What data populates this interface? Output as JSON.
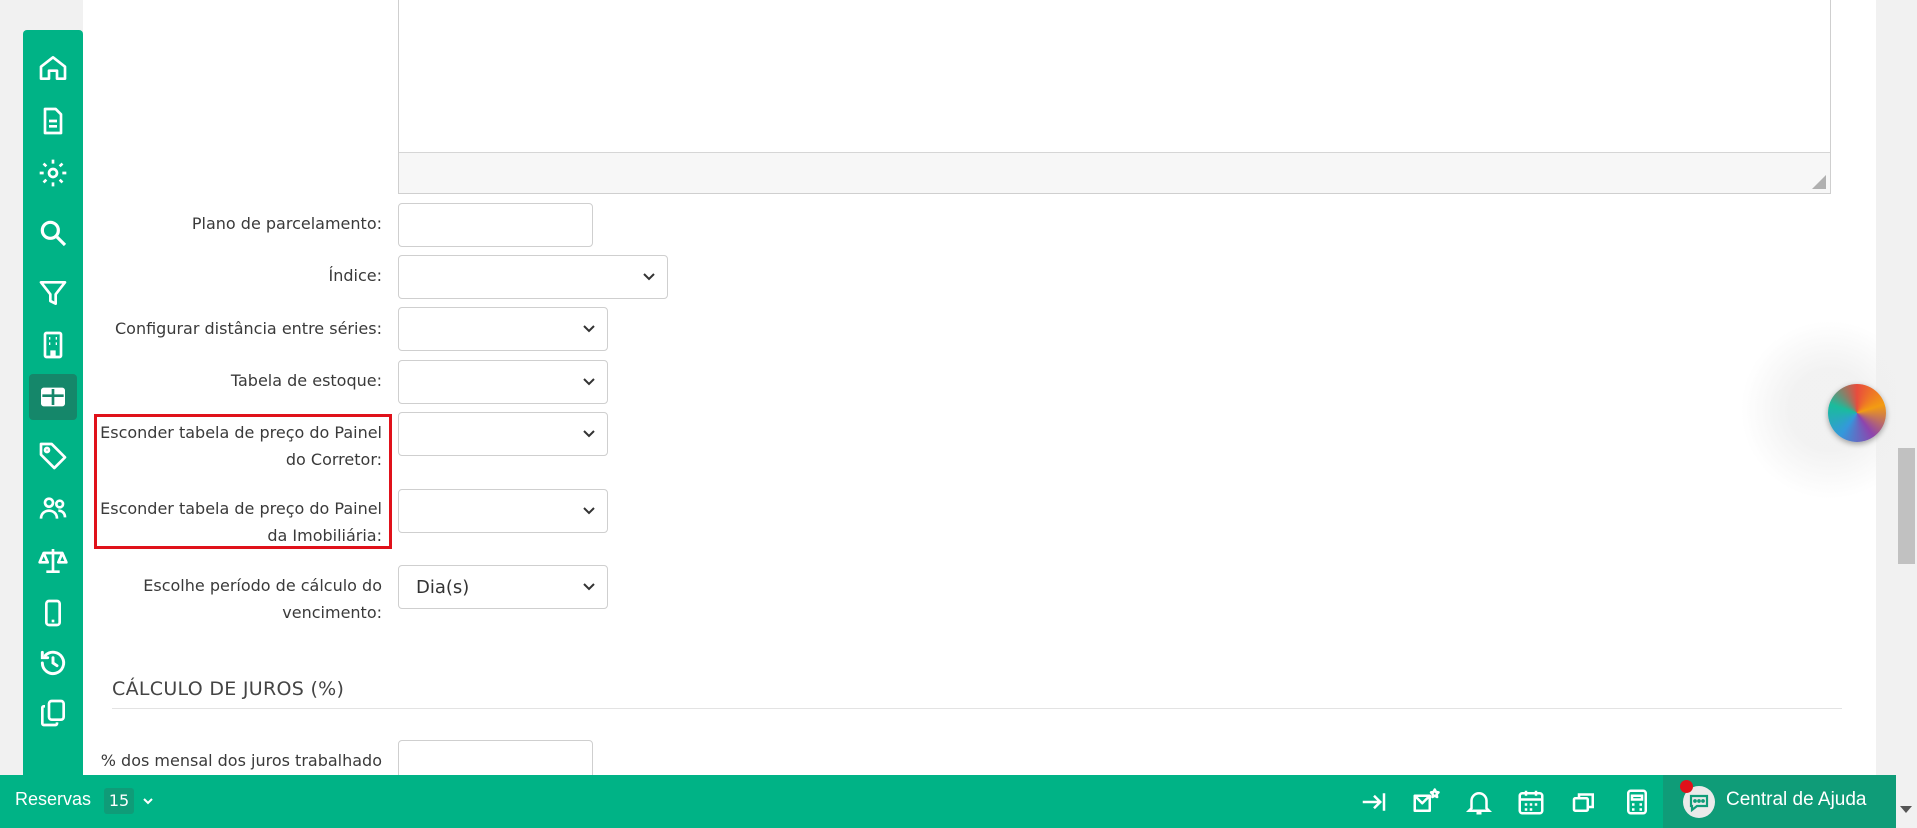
{
  "form": {
    "plano_label": "Plano de parcelamento:",
    "indice_label": "Índice:",
    "distancia_label": "Configurar distância entre séries:",
    "tabela_estoque_label": "Tabela de estoque:",
    "esconder_corretor_line1": "Esconder tabela de preço do Painel",
    "esconder_corretor_line2": "do Corretor:",
    "esconder_imob_line1": "Esconder tabela de preço do Painel",
    "esconder_imob_line2": "da Imobiliária:",
    "periodo_line1": "Escolhe período de cálculo do",
    "periodo_line2": "vencimento:",
    "periodo_value": "Dia(s)",
    "juros_label": "% dos mensal dos juros trabalhado"
  },
  "section": {
    "title": "CÁLCULO DE JUROS (%)"
  },
  "bottombar": {
    "reservas_label": "Reservas",
    "reservas_count": "15",
    "help_label": "Central de Ajuda"
  },
  "sidebar": {
    "items": [
      "home-icon",
      "document-icon",
      "gear-icon",
      "search-icon",
      "filter-icon",
      "building-icon",
      "table-icon",
      "tag-icon",
      "users-icon",
      "scales-icon",
      "mobile-icon",
      "history-icon",
      "copy-icon"
    ],
    "active": "table-icon"
  },
  "colors": {
    "brand": "#00b386",
    "brand_dark": "#0f9c78",
    "highlight": "#e0111a"
  }
}
